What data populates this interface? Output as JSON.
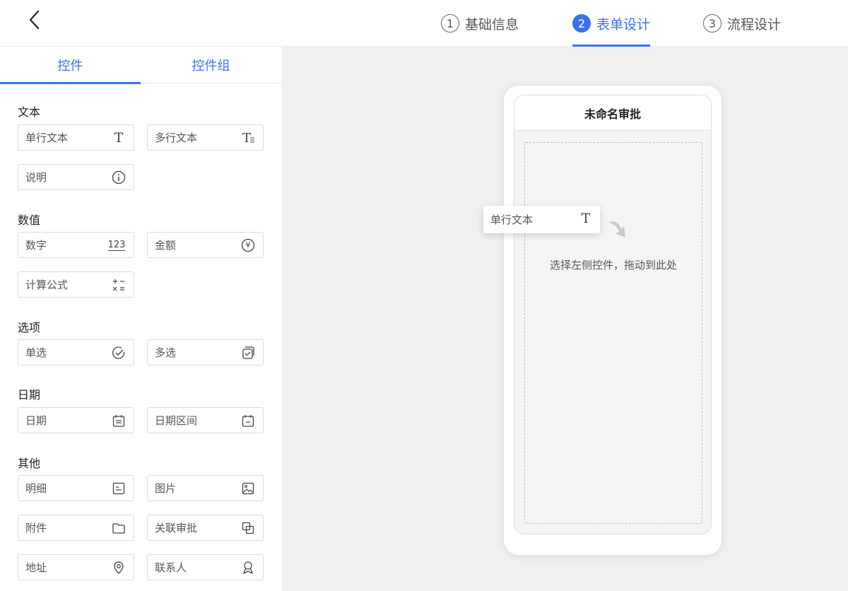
{
  "steps": [
    {
      "num": "1",
      "label": "基础信息",
      "active": false
    },
    {
      "num": "2",
      "label": "表单设计",
      "active": true
    },
    {
      "num": "3",
      "label": "流程设计",
      "active": false
    }
  ],
  "tabs": [
    {
      "label": "控件",
      "active": true
    },
    {
      "label": "控件组",
      "active": false
    }
  ],
  "sections": {
    "text": {
      "title": "文本",
      "items": [
        {
          "label": "单行文本",
          "icon": "text-icon"
        },
        {
          "label": "多行文本",
          "icon": "multiline-text-icon"
        },
        {
          "label": "说明",
          "icon": "info-icon"
        }
      ]
    },
    "number": {
      "title": "数值",
      "items": [
        {
          "label": "数字",
          "icon": "number-icon",
          "glyph": "123"
        },
        {
          "label": "金额",
          "icon": "yen-icon",
          "glyph": "¥"
        },
        {
          "label": "计算公式",
          "icon": "formula-icon"
        }
      ]
    },
    "option": {
      "title": "选项",
      "items": [
        {
          "label": "单选",
          "icon": "check-circle-icon"
        },
        {
          "label": "多选",
          "icon": "multi-check-icon"
        }
      ]
    },
    "date": {
      "title": "日期",
      "items": [
        {
          "label": "日期",
          "icon": "calendar-icon"
        },
        {
          "label": "日期区间",
          "icon": "calendar-range-icon"
        }
      ]
    },
    "other": {
      "title": "其他",
      "items": [
        {
          "label": "明细",
          "icon": "detail-icon"
        },
        {
          "label": "图片",
          "icon": "image-icon"
        },
        {
          "label": "附件",
          "icon": "folder-icon"
        },
        {
          "label": "关联审批",
          "icon": "link-approval-icon"
        },
        {
          "label": "地址",
          "icon": "location-icon"
        },
        {
          "label": "联系人",
          "icon": "contact-icon"
        }
      ]
    }
  },
  "phone": {
    "title": "未命名审批",
    "drop_hint": "选择左侧控件，拖动到此处"
  },
  "drag_ghost": {
    "label": "单行文本",
    "icon": "text-icon"
  },
  "colors": {
    "accent": "#3a73e8",
    "canvas": "#eff0f2"
  }
}
